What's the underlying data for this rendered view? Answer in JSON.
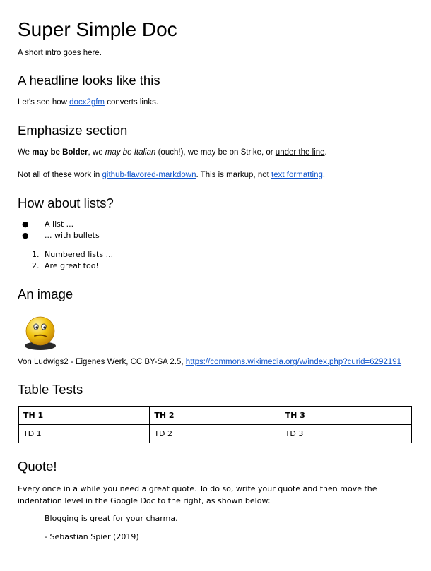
{
  "title": "Super Simple Doc",
  "intro": "A short intro goes here.",
  "sections": {
    "headline": {
      "heading": "A headline looks like this",
      "text_before": "Let's see how ",
      "link": "docx2gfm",
      "text_after": " converts links."
    },
    "emphasize": {
      "heading": "Emphasize section",
      "p1": {
        "t1": "We ",
        "bold": "may be Bolder",
        "t2": ", we ",
        "italic": "may be Italian",
        "t3": " (ouch!), we ",
        "strike": "may be on Strike",
        "t4": ", or ",
        "underline": "under the line",
        "t5": "."
      },
      "p2": {
        "t1": "Not all of these work in ",
        "link1": "github-flavored-markdown",
        "t2": ". This is markup, not ",
        "link2": "text formatting",
        "t3": "."
      }
    },
    "lists": {
      "heading": "How about lists?",
      "bullet_symbol": "●",
      "bullets": [
        "A list ...",
        "... with bullets"
      ],
      "numbered": [
        {
          "num": "1.",
          "text": "Numbered lists ..."
        },
        {
          "num": "2.",
          "text": "Are great too!"
        }
      ]
    },
    "image": {
      "heading": "An image",
      "icon": "confused-smiley-face",
      "caption_text": "Von Ludwigs2 - Eigenes Werk, CC BY-SA 2.5, ",
      "caption_link": "https://commons.wikimedia.org/w/index.php?curid=6292191"
    },
    "table": {
      "heading": "Table Tests",
      "headers": [
        "TH 1",
        "TH 2",
        "TH 3"
      ],
      "rows": [
        [
          "TD 1",
          "TD 2",
          "TD 3"
        ]
      ]
    },
    "quote": {
      "heading": "Quote!",
      "text": "Every once in a while you need a great quote. To do so, write your quote and then move the indentation level in the Google Doc to the right, as shown below:",
      "quote_line": "Blogging is great for your charma.",
      "attribution": "- Sebastian Spier (2019)"
    }
  },
  "colors": {
    "link": "#1155cc",
    "text": "#000000"
  }
}
